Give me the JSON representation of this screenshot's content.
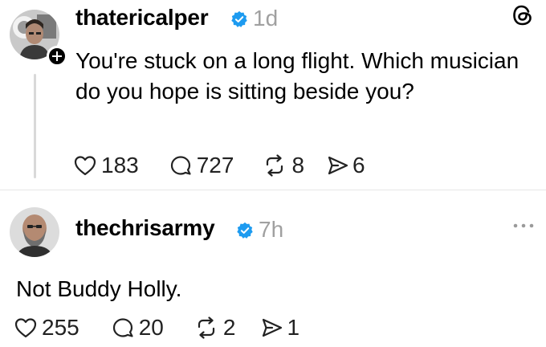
{
  "post": {
    "username": "thatericalper",
    "time": "1d",
    "text": "You're stuck on a long flight. Which musician do you hope is sitting beside you?",
    "likes": "183",
    "replies": "727",
    "reposts": "8",
    "shares": "6"
  },
  "reply": {
    "username": "thechrisarmy",
    "time": "7h",
    "text": "Not Buddy Holly.",
    "likes": "255",
    "replies": "20",
    "reposts": "2",
    "shares": "1"
  },
  "icons": {
    "verified": "verified-badge-icon",
    "like": "heart-icon",
    "reply": "comment-icon",
    "repost": "repost-icon",
    "share": "send-icon",
    "logo": "threads-logo-icon",
    "more": "more-icon",
    "follow": "plus-icon"
  },
  "colors": {
    "verified": "#1d9bf0",
    "muted": "#a0a0a0",
    "text": "#000000"
  }
}
